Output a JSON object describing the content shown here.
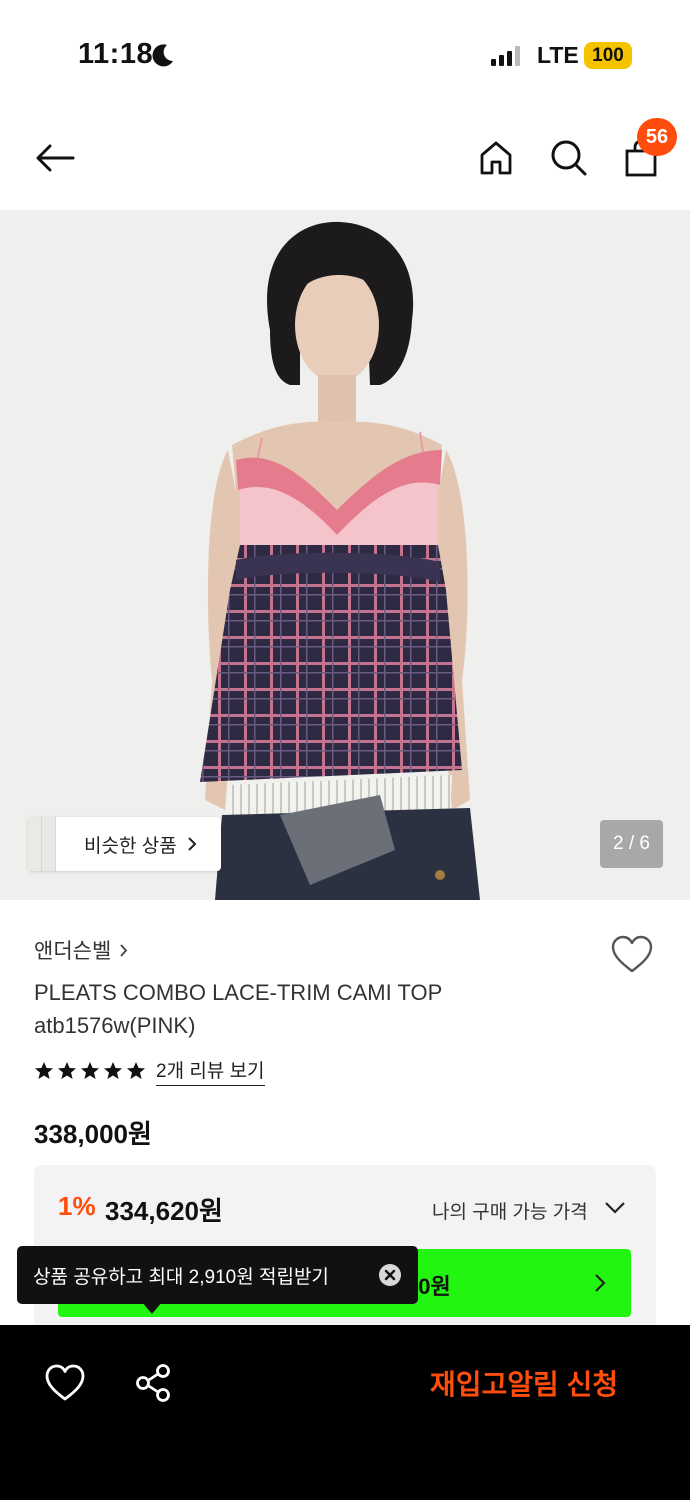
{
  "status_bar": {
    "time": "11:18",
    "network": "LTE",
    "battery": "100"
  },
  "header": {
    "cart_count": "56"
  },
  "icons": {
    "back": "arrow-left-icon",
    "home": "home-icon",
    "search": "search-icon",
    "cart": "shopping-bag-icon",
    "wish": "heart-icon",
    "share": "share-icon",
    "close": "close-circle-icon",
    "moon": "moon-icon"
  },
  "colors": {
    "accent": "#ff4d0d",
    "coupon_green": "#22f510",
    "dark_bar": "#000000"
  },
  "gallery": {
    "similar_label": "비슷한 상품",
    "counter": "2 / 6"
  },
  "product": {
    "brand": "앤더슨벨",
    "name": "PLEATS COMBO LACE-TRIM CAMI TOP atb1576w(PINK)",
    "rating_stars": 5,
    "review_link": "2개 리뷰 보기",
    "price": "338,000원"
  },
  "discount": {
    "rate": "1%",
    "price": "334,620원",
    "my_price_label": "나의 구매 가능 가격",
    "coupon_amount_visible": "20원"
  },
  "tooltip": {
    "text": "상품 공유하고 최대 2,910원 적립받기"
  },
  "bottom_bar": {
    "restock_label": "재입고알림 신청"
  }
}
